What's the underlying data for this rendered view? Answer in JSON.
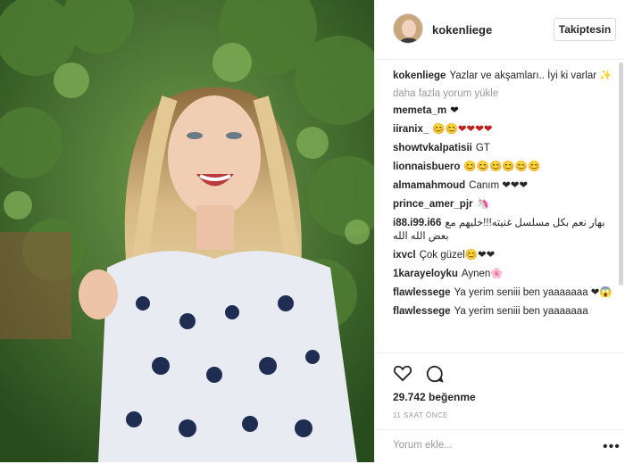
{
  "post": {
    "username": "kokenliege",
    "follow_label": "Takiptesin",
    "caption_user": "kokenliege",
    "caption_text": "Yazlar ve akşamları.. İyi ki varlar ✨",
    "load_more": "daha fazla yorum yükle",
    "comments": [
      {
        "user": "memeta_m",
        "text": "❤"
      },
      {
        "user": "iiranix_",
        "text": "😊😊❤❤❤❤"
      },
      {
        "user": "showtvkalpatisii",
        "text": "GT"
      },
      {
        "user": "lionnaisbuero",
        "text": "😊😊😊😊😊😊"
      },
      {
        "user": "almamahmoud",
        "text": "Canım ❤❤❤"
      },
      {
        "user": "prince_amer_pjr",
        "text": "🦄"
      },
      {
        "user": "i88.i99.i66",
        "text": "بهار نعم بكل مسلسل غنيته!!!خليهم مع بعض الله الله"
      },
      {
        "user": "ixvcl",
        "text": "Çok güzel😊❤❤"
      },
      {
        "user": "1karayeloyku",
        "text": "Aynen🌸"
      },
      {
        "user": "flawlessege",
        "text": "Ya yerim seniii ben yaaaaaaa ❤😱"
      },
      {
        "user": "flawlessege",
        "text": "Ya yerim seniii ben yaaaaaaa"
      }
    ],
    "likes": "29.742 beğenme",
    "time_ago": "11 SAAT ÖNCE",
    "comment_placeholder": "Yorum ekle...",
    "more_options": "•••"
  },
  "icons": [
    "heart-icon",
    "comment-icon"
  ],
  "colors": {
    "border": "#efefef",
    "muted": "#999999",
    "text": "#262626",
    "heart_red": "#c41b1b"
  }
}
